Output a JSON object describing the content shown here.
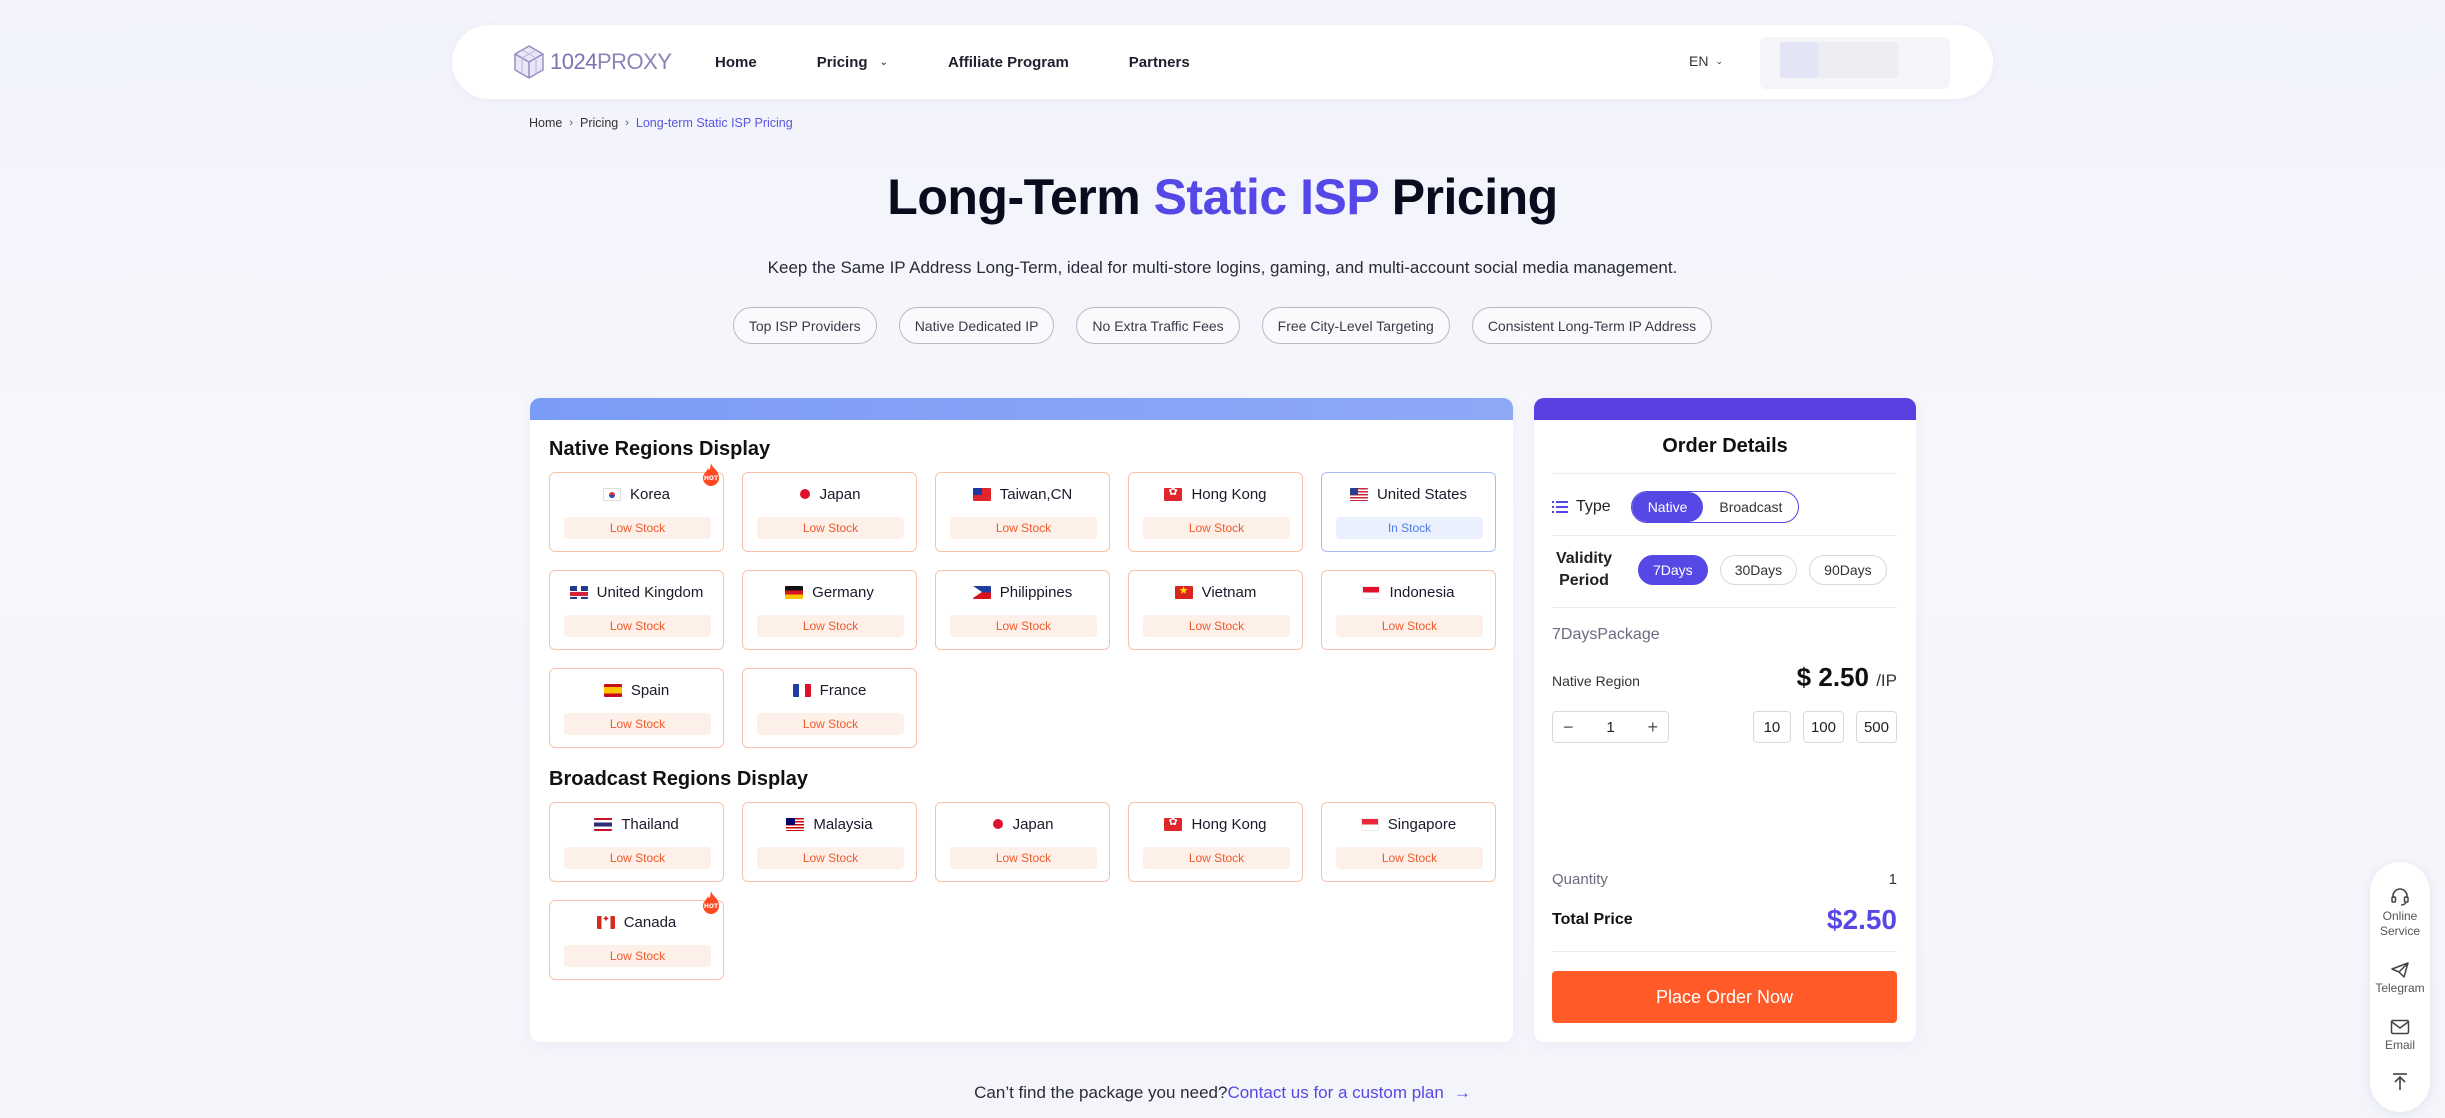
{
  "nav": {
    "logo_number": "1024",
    "logo_word": "PROXY",
    "links": [
      "Home",
      "Pricing",
      "Affiliate Program",
      "Partners"
    ],
    "language": "EN"
  },
  "breadcrumb": [
    "Home",
    "Pricing",
    "Long-term Static ISP Pricing"
  ],
  "hero": {
    "title_part1": "Long-Term ",
    "title_accent": "Static ISP",
    "title_part2": " Pricing",
    "subtitle": "Keep the Same IP Address Long-Term, ideal for multi-store logins, gaming, and multi-account social media management.",
    "features": [
      "Top ISP Providers",
      "Native Dedicated IP",
      "No Extra Traffic Fees",
      "Free City-Level Targeting",
      "Consistent Long-Term IP Address"
    ]
  },
  "native_regions": {
    "title": "Native Regions Display",
    "items": [
      {
        "name": "Korea",
        "status": "Low Stock",
        "flag": "kr",
        "hot": true
      },
      {
        "name": "Japan",
        "status": "Low Stock",
        "flag": "jp"
      },
      {
        "name": "Taiwan,CN",
        "status": "Low Stock",
        "flag": "tw"
      },
      {
        "name": "Hong Kong",
        "status": "Low Stock",
        "flag": "hk"
      },
      {
        "name": "United States",
        "status": "In Stock",
        "flag": "us",
        "selected": true
      },
      {
        "name": "United Kingdom",
        "status": "Low Stock",
        "flag": "uk"
      },
      {
        "name": "Germany",
        "status": "Low Stock",
        "flag": "de"
      },
      {
        "name": "Philippines",
        "status": "Low Stock",
        "flag": "ph"
      },
      {
        "name": "Vietnam",
        "status": "Low Stock",
        "flag": "vn"
      },
      {
        "name": "Indonesia",
        "status": "Low Stock",
        "flag": "id"
      },
      {
        "name": "Spain",
        "status": "Low Stock",
        "flag": "es"
      },
      {
        "name": "France",
        "status": "Low Stock",
        "flag": "fr"
      }
    ]
  },
  "broadcast_regions": {
    "title": "Broadcast Regions Display",
    "items": [
      {
        "name": "Thailand",
        "status": "Low Stock",
        "flag": "th"
      },
      {
        "name": "Malaysia",
        "status": "Low Stock",
        "flag": "my"
      },
      {
        "name": "Japan",
        "status": "Low Stock",
        "flag": "jp"
      },
      {
        "name": "Hong Kong",
        "status": "Low Stock",
        "flag": "hk"
      },
      {
        "name": "Singapore",
        "status": "Low Stock",
        "flag": "sg"
      },
      {
        "name": "Canada",
        "status": "Low Stock",
        "flag": "ca",
        "hot": true
      }
    ]
  },
  "hot_badge": "HOT",
  "order": {
    "title": "Order Details",
    "type_label": "Type",
    "type_options": [
      "Native",
      "Broadcast"
    ],
    "type_selected": "Native",
    "validity_label": "Validity Period",
    "validity_options": [
      "7Days",
      "30Days",
      "90Days"
    ],
    "validity_selected": "7Days",
    "package_name": "7DaysPackage",
    "region_label": "Native Region",
    "price": "$ 2.50",
    "price_unit": "/IP",
    "quantity_value": "1",
    "quantity_presets": [
      "10",
      "100",
      "500"
    ],
    "quantity_label": "Quantity",
    "quantity_summary": "1",
    "total_label": "Total Price",
    "total_value": "$2.50",
    "submit_label": "Place Order Now"
  },
  "custom_plan": {
    "prefix": "Can’t find the package you need?",
    "link": "Contact us for a custom plan"
  },
  "side_bar": {
    "online_service": "Online Service",
    "telegram": "Telegram",
    "email": "Email"
  },
  "colors": {
    "accent": "#5548e6",
    "order_button": "#ff5a27",
    "low_stock": "#ef5a2d",
    "in_stock": "#4c7de8"
  }
}
